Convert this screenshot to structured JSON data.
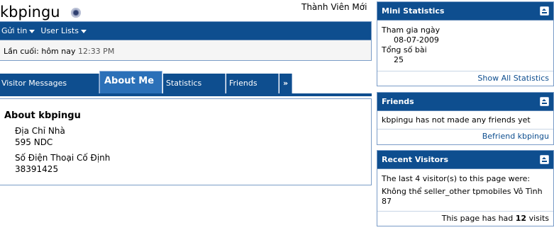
{
  "profile": {
    "username": "kbpingu",
    "member_title": "Thành Viên Mới",
    "last_activity_label": "Lần cuối: hôm nay",
    "last_activity_time": "12:33 PM"
  },
  "user_bar": {
    "send_label": "Gửi tin",
    "lists_label": "User Lists"
  },
  "tabs": [
    {
      "label": "Visitor Messages"
    },
    {
      "label": "About Me"
    },
    {
      "label": "Statistics"
    },
    {
      "label": "Friends"
    },
    {
      "label": "»"
    }
  ],
  "about": {
    "heading": "About kbpingu",
    "fields": [
      {
        "label": "Địa Chỉ Nhà",
        "value": "595 NDC"
      },
      {
        "label": "Số Điện Thoại Cố Định",
        "value": "38391425"
      }
    ]
  },
  "mini_stats": {
    "title": "Mini Statistics",
    "join_label": "Tham gia ngày",
    "join_value": "08-07-2009",
    "posts_label": "Tổng số bài",
    "posts_value": "25",
    "footer_link": "Show All Statistics"
  },
  "friends": {
    "title": "Friends",
    "message": "kbpingu has not made any friends yet",
    "footer_link": "Befriend kbpingu"
  },
  "recent_visitors": {
    "title": "Recent Visitors",
    "intro": "The last 4 visitor(s) to this page were:",
    "visitors": [
      "Không thể",
      "seller_other",
      "tpmobiles",
      "Vô Tình 87"
    ],
    "footer_prefix": "This page has had",
    "footer_count": "12",
    "footer_suffix": "visits"
  },
  "colors": {
    "header_blue": "#0e4e8f",
    "selected_tab_blue": "#2b70b8",
    "border_blue": "#7a9cc7"
  }
}
